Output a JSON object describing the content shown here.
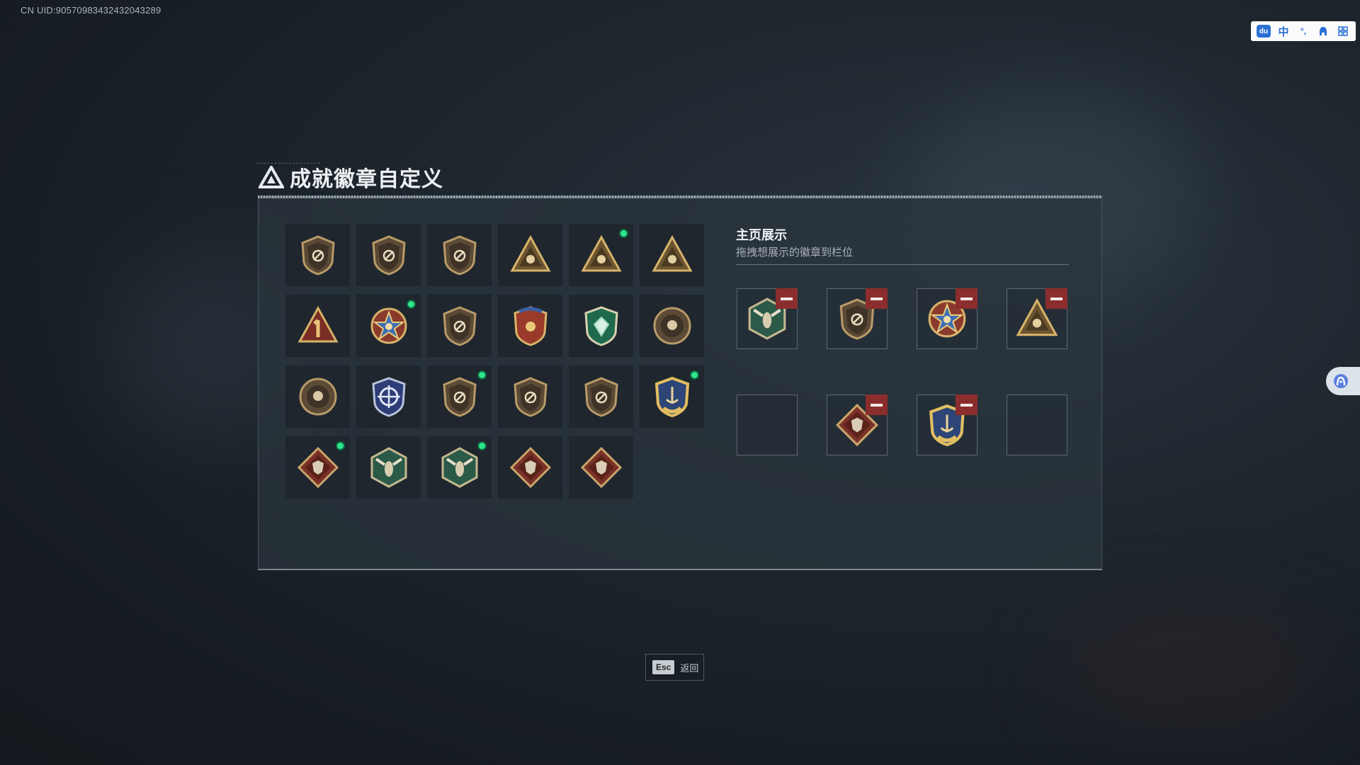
{
  "uid_text": "CN UID:9057098343243​2043289",
  "ime": {
    "logo": "du",
    "lang": "中",
    "punct": "°,",
    "items": [
      "ime-logo-icon",
      "lang-indicator",
      "punctuation-icon",
      "user-icon",
      "grid-icon"
    ]
  },
  "title": "成就徽章自定义",
  "showcase": {
    "title": "主页展示",
    "subtitle": "拖拽想展示的徽章到栏位"
  },
  "badges": [
    {
      "icon": "triangle-shield-badge-icon",
      "style": "bronze",
      "new": false
    },
    {
      "icon": "helicopter-badge-icon",
      "style": "bronze",
      "new": false
    },
    {
      "icon": "wings-shield-badge-icon",
      "style": "bronze",
      "new": false
    },
    {
      "icon": "map-triangle-badge-icon",
      "style": "gold-triangle",
      "new": false
    },
    {
      "icon": "s6-triangle-badge-icon",
      "style": "gold-triangle",
      "new": true
    },
    {
      "icon": "wave-triangle-badge-icon",
      "style": "gold-triangle",
      "new": false
    },
    {
      "icon": "rank-one-badge-icon",
      "style": "red-triangle",
      "new": false
    },
    {
      "icon": "star-medal-badge-icon",
      "style": "star",
      "new": true
    },
    {
      "icon": "fist-shield-badge-icon",
      "style": "bronze",
      "new": false
    },
    {
      "icon": "eagle-shield-badge-icon",
      "style": "red-shield",
      "new": false
    },
    {
      "icon": "emerald-shield-badge-icon",
      "style": "green",
      "new": false
    },
    {
      "icon": "skull-target-badge-icon",
      "style": "bronze-round",
      "new": false
    },
    {
      "icon": "tiger-round-badge-icon",
      "style": "bronze-round",
      "new": false
    },
    {
      "icon": "crosshair-shield-badge-icon",
      "style": "blue",
      "new": false
    },
    {
      "icon": "no-gun-shield-badge-icon",
      "style": "bronze",
      "new": true
    },
    {
      "icon": "no-gun-shield-badge-icon",
      "style": "bronze",
      "new": false
    },
    {
      "icon": "no-gun-shield-badge-icon",
      "style": "bronze",
      "new": false
    },
    {
      "icon": "anchor-shield-badge-icon",
      "style": "gold-blue",
      "new": true
    },
    {
      "icon": "wolf-diamond-badge-icon",
      "style": "red-diamond",
      "new": true
    },
    {
      "icon": "wasp-hex-badge-icon",
      "style": "green-hex",
      "new": false
    },
    {
      "icon": "wasp-hex-badge-icon",
      "style": "green-hex",
      "new": true
    },
    {
      "icon": "dragon-diamond-badge-icon",
      "style": "red-diamond",
      "new": false
    },
    {
      "icon": "runner-diamond-badge-icon",
      "style": "red-diamond",
      "new": false
    }
  ],
  "slots": [
    {
      "icon": "wasp-hex-badge-icon",
      "style": "green-hex",
      "filled": true
    },
    {
      "icon": "no-gun-shield-badge-icon",
      "style": "bronze",
      "filled": true
    },
    {
      "icon": "star-medal-badge-icon",
      "style": "star",
      "filled": true
    },
    {
      "icon": "s6-triangle-badge-icon",
      "style": "gold-triangle",
      "filled": true
    },
    {
      "icon": "",
      "style": "",
      "filled": false
    },
    {
      "icon": "wolf-diamond-badge-icon",
      "style": "red-diamond",
      "filled": true
    },
    {
      "icon": "anchor-shield-badge-icon",
      "style": "gold-blue",
      "filled": true
    },
    {
      "icon": "",
      "style": "",
      "filled": false
    }
  ],
  "footer": {
    "key": "Esc",
    "label": "返回"
  },
  "colors": {
    "new_dot": "#2ee68c",
    "remove": "#8c2d2d",
    "accent_blue": "#2b6fd6"
  }
}
